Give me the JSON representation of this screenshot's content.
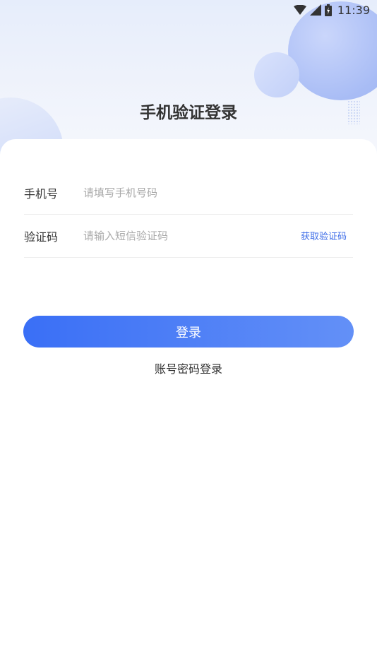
{
  "status_bar": {
    "time": "11:39",
    "icons": [
      "wifi-icon",
      "signal-icon",
      "battery-icon"
    ]
  },
  "page": {
    "title": "手机验证登录"
  },
  "form": {
    "phone": {
      "label": "手机号",
      "placeholder": "请填写手机号码",
      "value": ""
    },
    "code": {
      "label": "验证码",
      "placeholder": "请输入短信验证码",
      "value": "",
      "get_code_label": "获取验证码"
    }
  },
  "actions": {
    "login_label": "登录",
    "alt_login_label": "账号密码登录"
  },
  "colors": {
    "primary": "#3a6ff6",
    "primary_light": "#6390f7",
    "link": "#3f6ee8",
    "text": "#333333",
    "placeholder": "#aaaaaa"
  }
}
